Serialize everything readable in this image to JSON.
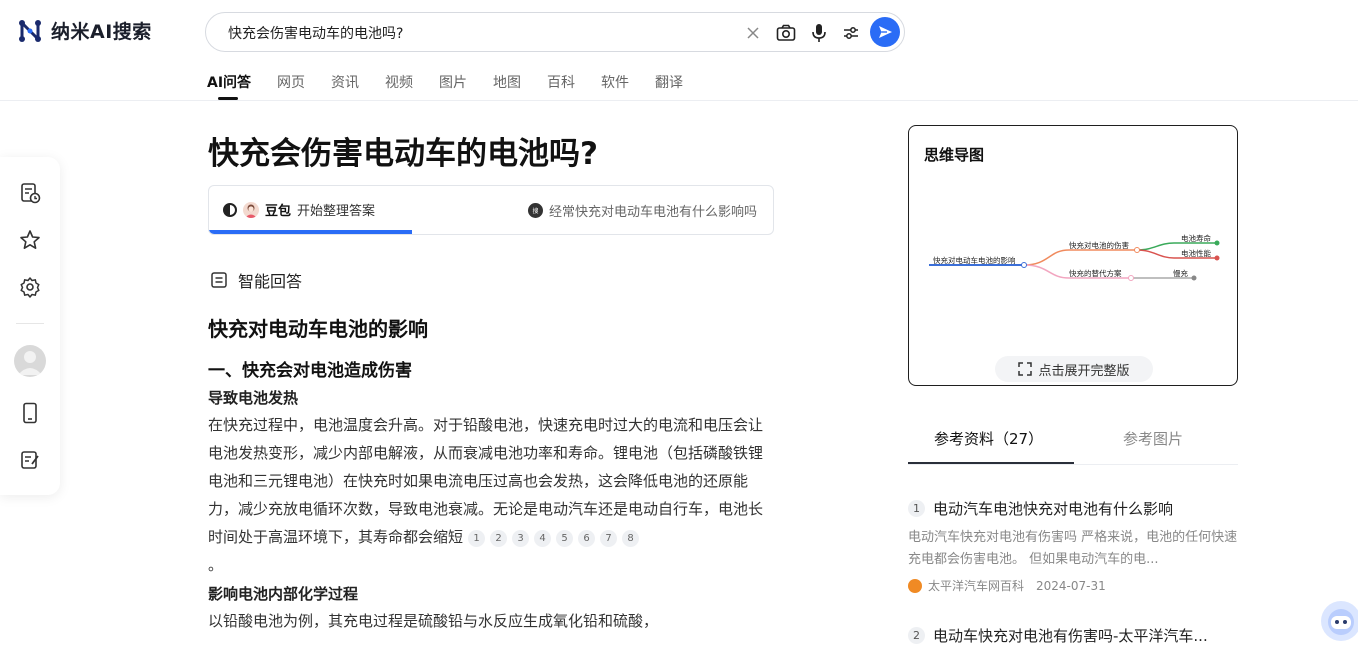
{
  "app": {
    "name": "纳米AI搜索"
  },
  "search": {
    "query": "快充会伤害电动车的电池吗?"
  },
  "tabs": [
    "AI问答",
    "网页",
    "资讯",
    "视频",
    "图片",
    "地图",
    "百科",
    "软件",
    "翻译"
  ],
  "active_tab": "AI问答",
  "question": {
    "title": "快充会伤害电动车的电池吗?"
  },
  "progress": {
    "model": "豆包",
    "status": "开始整理答案",
    "related_query": "经常快充对电动车电池有什么影响吗",
    "fraction": 0.36
  },
  "answer": {
    "section_label": "智能回答",
    "h1": "快充对电动车电池的影响",
    "h2": "一、快充会对电池造成伤害",
    "h3_1": "导致电池发热",
    "para_1": "在快充过程中，电池温度会升高。对于铅酸电池，快速充电时过大的电流和电压会让电池发热变形，减少内部电解液，从而衰减电池功率和寿命。锂电池（包括磷酸铁锂电池和三元锂电池）在快充时如果电流电压过高也会发热，这会降低电池的还原能力，减少充放电循环次数，导致电池衰减。无论是电动汽车还是电动自行车，电池长时间处于高温环境下，其寿命都会缩短",
    "citations": [
      "1",
      "2",
      "3",
      "4",
      "5",
      "6",
      "7",
      "8"
    ],
    "para_1_end": "。",
    "h3_2": "影响电池内部化学过程",
    "para_2": "以铅酸电池为例，其充电过程是硫酸铅与水反应生成氧化铅和硫酸，"
  },
  "mindmap": {
    "title": "思维导图",
    "root": "快充对电动车电池的影响",
    "branch_1": "快充对电池的伤害",
    "leaf_1": "电池寿命",
    "leaf_2": "电池性能",
    "branch_2": "快充的替代方案",
    "leaf_3": "慢充",
    "expand_label": "点击展开完整版"
  },
  "references": {
    "tab_active": "参考资料（27）",
    "tab_other": "参考图片",
    "items": [
      {
        "num": "1",
        "title": "电动汽车电池快充对电池有什么影响",
        "snippet": "电动汽车快充对电池有伤害吗 严格来说，电池的任何快速充电都会伤害电池。 但如果电动汽车的电...",
        "source": "太平洋汽车网百科",
        "date": "2024-07-31"
      },
      {
        "num": "2",
        "title": "电动车快充对电池有伤害吗-太平洋汽车..."
      }
    ]
  },
  "colors": {
    "accent": "#2a6cf6",
    "mm_green": "#3aaa5a",
    "mm_red": "#d9534f",
    "mm_orange": "#f08a5d",
    "mm_blue": "#3b6fd8"
  }
}
